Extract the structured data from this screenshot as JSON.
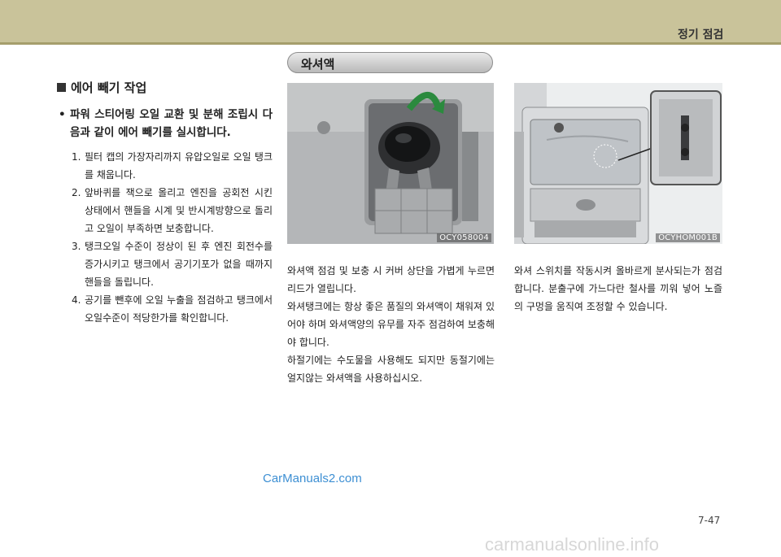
{
  "header": {
    "section_title": "정기 점검"
  },
  "washer": {
    "title": "와셔액"
  },
  "left": {
    "heading": "에어 빼기 작업",
    "bullet_mark": "•",
    "bullet": "파워 스티어링 오일 교환 및 분해 조립시 다음과 같이 에어 빼기를 실시합니다.",
    "steps": [
      {
        "num": "1.",
        "text": "필터 캡의 가장자리까지 유압오일로 오일 탱크를 채웁니다."
      },
      {
        "num": "2.",
        "text": "앞바퀴를 잭으로 올리고 엔진을 공회전 시킨 상태에서 핸들을 시계 및 반시계방향으로 돌리고 오일이 부족하면 보충합니다."
      },
      {
        "num": "3.",
        "text": "탱크오일 수준이 정상이 된 후 엔진 회전수를 증가시키고 탱크에서 공기기포가 없을 때까지 핸들을 돌립니다."
      },
      {
        "num": "4.",
        "text": "공기를 뺀후에 오일 누출을 점검하고 탱크에서 오일수준이 적당한가를 확인합니다."
      }
    ]
  },
  "photo1": {
    "code": "OCY058004"
  },
  "photo2": {
    "code": "OCYHOM001B"
  },
  "middle": {
    "paragraphs": [
      "와셔액 점검 및 보충 시 커버 상단을 가볍게 누르면 리드가 열립니다.",
      "와셔탱크에는 항상 좋은 품질의 와셔액이 채워져 있어야 하며 와셔액양의 유무를 자주 점검하여 보충해야 합니다.",
      "하절기에는 수도물을 사용해도 되지만 동절기에는 얼지않는 와셔액을 사용하십시오."
    ]
  },
  "right": {
    "paragraph": "와셔 스위치를 작동시켜 올바르게 분사되는가 점검합니다. 분출구에 가느다란 철사를 끼워 넣어 노즐의 구멍을 움직여 조정할 수 있습니다."
  },
  "footer": {
    "watermark_top": "CarManuals2.com",
    "page_number": "7-47",
    "watermark_bottom": "carmanualsonline.info"
  }
}
